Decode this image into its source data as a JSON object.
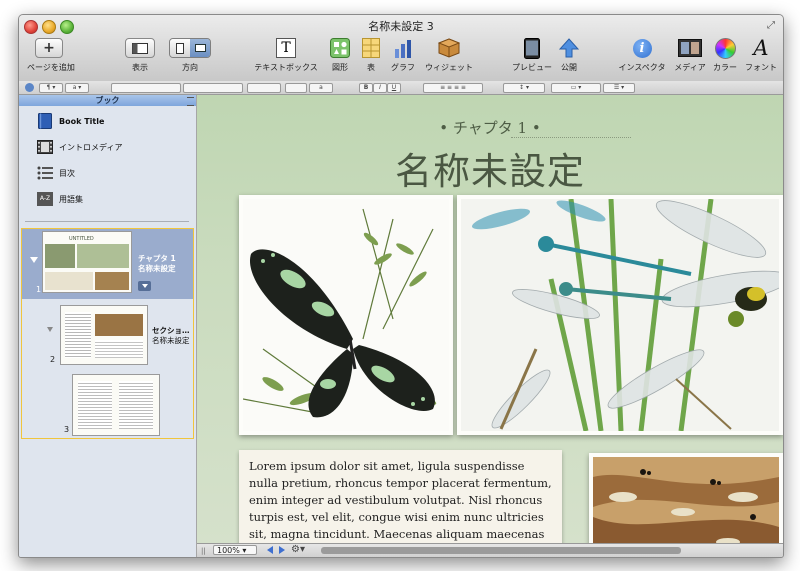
{
  "window": {
    "title": "名称未設定 3"
  },
  "toolbar": {
    "add_page": "ページを追加",
    "view": "表示",
    "orientation": "方向",
    "textbox": "テキストボックス",
    "shapes": "図形",
    "table": "表",
    "chart": "グラフ",
    "widget": "ウィジェット",
    "preview": "プレビュー",
    "publish": "公開",
    "inspector": "インスペクタ",
    "media": "メディア",
    "colors": "カラー",
    "fonts": "フォント"
  },
  "formatbar": {
    "font_size_value": "a",
    "bold": "B",
    "italic": "I",
    "underline": "U"
  },
  "sidebar": {
    "header": "ブック",
    "items": [
      {
        "label": "Book Title",
        "icon": "book-icon"
      },
      {
        "label": "イントロメディア",
        "icon": "film-icon"
      },
      {
        "label": "目次",
        "icon": "list-icon"
      },
      {
        "label": "用語集",
        "icon": "glossary-icon"
      }
    ],
    "glossary_icon_text": "A-Z",
    "chapter": {
      "label": "チャプタ 1",
      "title": "名称未設定",
      "page_num": "1",
      "thumb_title": "UNTITLED"
    },
    "section": {
      "label": "セクショ…",
      "title": "名称未設定",
      "page_num": "2"
    },
    "page3": {
      "page_num": "3"
    }
  },
  "canvas": {
    "chapter_label": "• チャプタ 1 •",
    "title": "名称未設定",
    "body_text": "Lorem ipsum dolor sit amet, ligula suspendisse nulla pretium, rhoncus tempor placerat fermentum, enim integer ad vestibulum volutpat. Nisl rhoncus turpis est, vel elit, congue wisi enim nunc ultricies sit, magna tincidunt. Maecenas aliquam maecenas ligula"
  },
  "status": {
    "zoom": "100%"
  },
  "colors": {
    "accent": "#7ea5dc",
    "selection": "#f0c53c",
    "canvas": "#c9dbbd"
  }
}
